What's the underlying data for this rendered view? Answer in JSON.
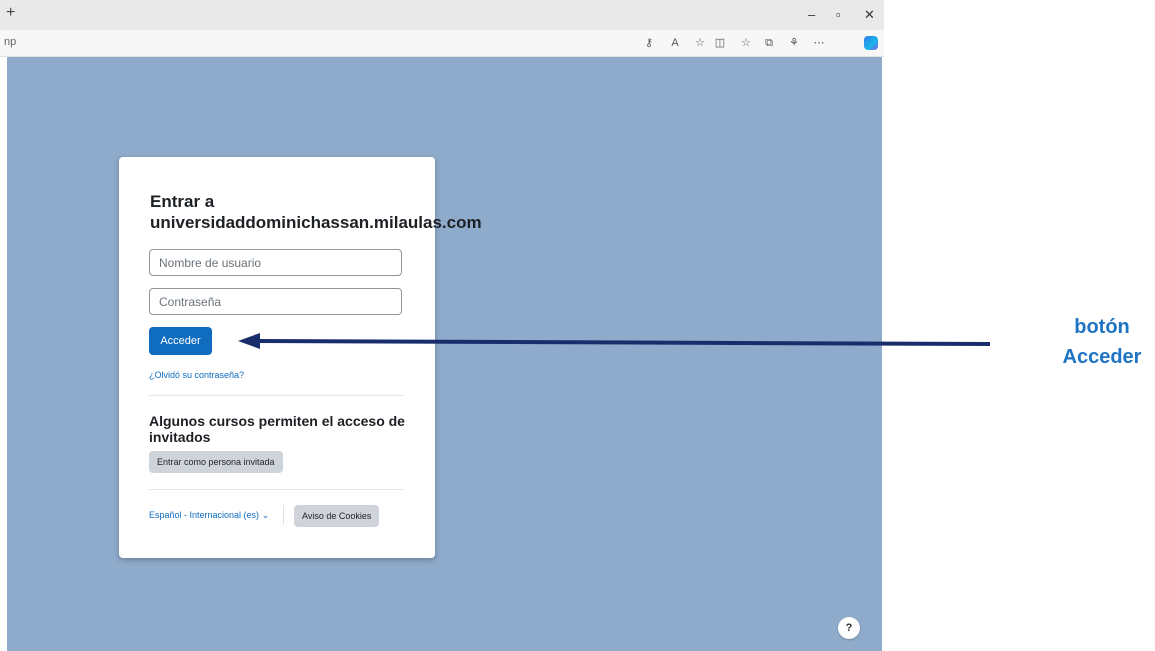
{
  "browser": {
    "new_tab_glyph": "+",
    "address_fragment": "np",
    "window_controls": {
      "minimize": "–",
      "restore": "▫",
      "close": "✕"
    },
    "toolbar_icons": [
      "key-icon",
      "read-aloud-icon",
      "favorite-star-icon",
      "split-screen-icon",
      "favorites-icon",
      "collections-icon",
      "extensions-icon",
      "more-icon",
      "copilot-icon"
    ]
  },
  "login": {
    "title_line1": "Entrar a",
    "title_line2": "universidaddominichassan.milaulas.com",
    "username_placeholder": "Nombre de usuario",
    "password_placeholder": "Contraseña",
    "submit_label": "Acceder",
    "forgot_link": "¿Olvidó su contraseña?",
    "guest_title": "Algunos cursos permiten el acceso de invitados",
    "guest_button": "Entrar como persona invitada",
    "language": "Español - Internacional (es)",
    "cookies_button": "Aviso de Cookies",
    "help": "?"
  },
  "annotation": {
    "line1": "botón",
    "line2": "Acceder",
    "color": "#1f74c4"
  },
  "colors": {
    "page_background": "#8fabcb",
    "primary": "#0f6cbf",
    "secondary_button": "#ced4da",
    "arrow": "#1a2d6b"
  }
}
